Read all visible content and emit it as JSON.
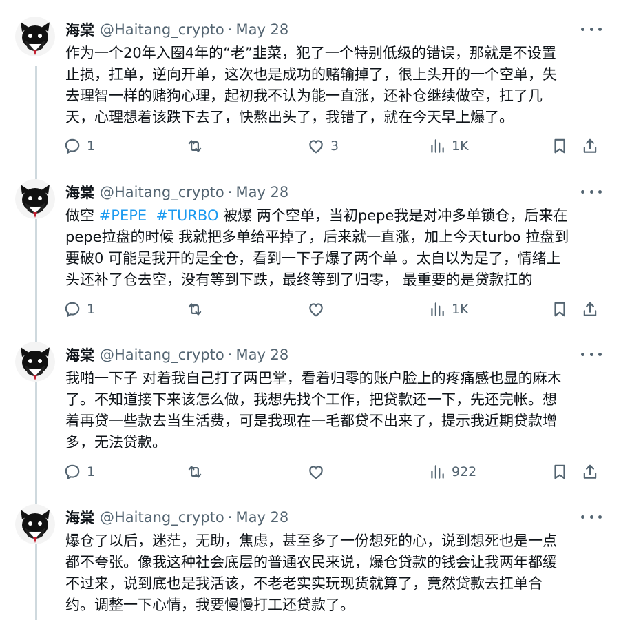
{
  "tweets": [
    {
      "name": "海棠",
      "handle": "@Haitang_crypto",
      "separator": "·",
      "date": "May 28",
      "text_lines": [
        "作为一个20年入圈4年的“老”韭菜，犯了一个特别低级的错误，那就是不设置",
        "止损，扛单，逆向开单，这次也是成功的赌输掉了，很上头开的一个空单，失",
        "去理智一样的赌狗心理，起初我不认为能一直涨，还补仓继续做空，扛了几",
        "天，心理想着该跌下去了，快熬出头了，我错了，就在今天早上爆了。"
      ],
      "replies": "1",
      "retweets": "",
      "likes": "3",
      "views": "1K"
    },
    {
      "name": "海棠",
      "handle": "@Haitang_crypto",
      "separator": "·",
      "date": "May 28",
      "text_prefix": "做空 ",
      "hashtag1": "#PEPE",
      "hashtag2": "#TURBO",
      "text_after_tags": " 被爆 两个空单，当初pepe我是对冲多单锁仓，后来在",
      "text_lines": [
        "pepe拉盘的时候 我就把多单给平掉了，后来就一直涨，加上今天turbo 拉盘到",
        "要破0 可能是我开的是全仓，看到一下子爆了两个单 。太自以为是了，情绪上",
        "头还补了仓去空，没有等到下跌，最终等到了归零， 最重要的是贷款扛的"
      ],
      "replies": "1",
      "retweets": "",
      "likes": "",
      "views": "1K"
    },
    {
      "name": "海棠",
      "handle": "@Haitang_crypto",
      "separator": "·",
      "date": "May 28",
      "text_lines": [
        "我啪一下子 对着我自己打了两巴掌，看着归零的账户脸上的疼痛感也显的麻木",
        "了。不知道接下来该怎么做，我想先找个工作，把贷款还一下，先还完帐。想",
        "着再贷一些款去当生活费，可是我现在一毛都贷不出来了，提示我近期贷款增",
        "多，无法贷款。"
      ],
      "replies": "1",
      "retweets": "",
      "likes": "",
      "views": "922"
    },
    {
      "name": "海棠",
      "handle": "@Haitang_crypto",
      "separator": "·",
      "date": "May 28",
      "text_lines": [
        "爆仓了以后，迷茫，无助，焦虑，甚至多了一份想死的心，说到想死也是一点",
        "都不夸张。像我这种社会底层的普通农民来说，爆仓贷款的钱会让我两年都缓",
        "不过来，说到底也是我活该，不老老实实玩现货就算了，竟然贷款去扛单合",
        "约。调整一下心情，我要慢慢打工还贷款了。"
      ]
    }
  ],
  "colors": {
    "text": "#0f1419",
    "secondary": "#536471",
    "hashtag": "#1d9bf0",
    "thread_line": "#cfd9de"
  },
  "icons": [
    "reply-icon",
    "retweet-icon",
    "like-icon",
    "views-icon",
    "bookmark-icon",
    "share-icon",
    "more-icon"
  ]
}
